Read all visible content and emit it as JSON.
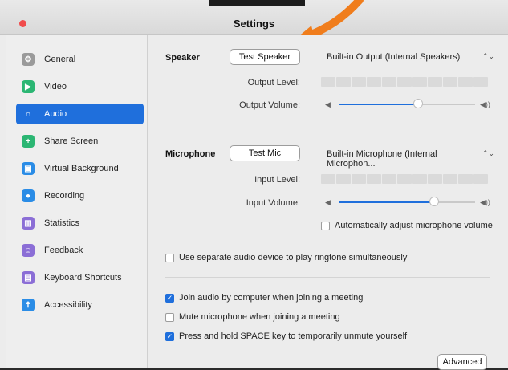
{
  "window": {
    "title": "Settings"
  },
  "sidebar": {
    "items": [
      {
        "label": "General",
        "icon": "gear-icon",
        "color": "#9a9a9a"
      },
      {
        "label": "Video",
        "icon": "video-camera-icon",
        "color": "#2bb673"
      },
      {
        "label": "Audio",
        "icon": "headphones-icon",
        "color": "#1f6fdc",
        "active": true
      },
      {
        "label": "Share Screen",
        "icon": "share-screen-icon",
        "color": "#2bb673"
      },
      {
        "label": "Virtual Background",
        "icon": "virtual-background-icon",
        "color": "#2a8ce6"
      },
      {
        "label": "Recording",
        "icon": "recording-icon",
        "color": "#2a8ce6"
      },
      {
        "label": "Statistics",
        "icon": "statistics-icon",
        "color": "#8b6ed6"
      },
      {
        "label": "Feedback",
        "icon": "feedback-icon",
        "color": "#8b6ed6"
      },
      {
        "label": "Keyboard Shortcuts",
        "icon": "keyboard-icon",
        "color": "#8b6ed6"
      },
      {
        "label": "Accessibility",
        "icon": "accessibility-icon",
        "color": "#2a8ce6"
      }
    ]
  },
  "speaker": {
    "section_label": "Speaker",
    "test_button": "Test Speaker",
    "device": "Built-in Output (Internal Speakers)",
    "output_level_label": "Output Level:",
    "output_volume_label": "Output Volume:",
    "volume_fraction": 0.58
  },
  "microphone": {
    "section_label": "Microphone",
    "test_button": "Test Mic",
    "device": "Built-in Microphone (Internal Microphon...",
    "input_level_label": "Input Level:",
    "input_volume_label": "Input Volume:",
    "volume_fraction": 0.7,
    "auto_adjust_label": "Automatically adjust microphone volume",
    "auto_adjust_checked": false
  },
  "options": {
    "separate_device_label": "Use separate audio device to play ringtone simultaneously",
    "separate_device_checked": false,
    "join_audio_label": "Join audio by computer when joining a meeting",
    "join_audio_checked": true,
    "mute_mic_label": "Mute microphone when joining a meeting",
    "mute_mic_checked": false,
    "space_unmute_label": "Press and hold SPACE key to temporarily unmute yourself",
    "space_unmute_checked": true
  },
  "advanced_button": "Advanced",
  "accent_color": "#1f6fdc"
}
